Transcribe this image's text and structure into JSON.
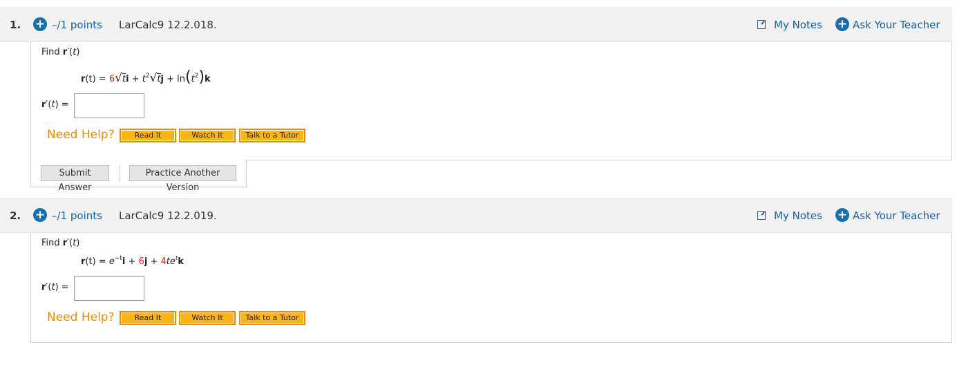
{
  "questions": [
    {
      "number": "1.",
      "points": "–/1 points",
      "code": "LarCalc9 12.2.018.",
      "my_notes": "My Notes",
      "ask_teacher": "Ask Your Teacher",
      "find": {
        "prefix": "Find ",
        "r": "r",
        "prime": "′(",
        "t": "t",
        "close": ")"
      },
      "equation": {
        "lhs": "r",
        "lhs_t": "(t)",
        "eq": " = ",
        "c1": "6",
        "rad1": "t",
        "i": "i",
        "plus1": " + ",
        "t2": "t",
        "sq": "2",
        "rad2": "t",
        "j": "j",
        "plus2": " + ",
        "ln": "ln",
        "arg_t": "t",
        "arg_sq": "2",
        "k": "k"
      },
      "answer_label": "r′(t) =",
      "need_help": "Need Help?",
      "buttons": [
        "Read It",
        "Watch It",
        "Talk to a Tutor"
      ],
      "submit": "Submit Answer",
      "practice": "Practice Another Version"
    },
    {
      "number": "2.",
      "points": "–/1 points",
      "code": "LarCalc9 12.2.019.",
      "my_notes": "My Notes",
      "ask_teacher": "Ask Your Teacher",
      "find": {
        "prefix": "Find ",
        "r": "r",
        "prime": "′(",
        "t": "t",
        "close": ")"
      },
      "equation": {
        "lhs": "r",
        "lhs_t": "(t)",
        "eq": " = ",
        "e": "e",
        "exp": "−t",
        "i": "i",
        "plus1": " + ",
        "c2": "6",
        "j": "j",
        "plus2": " + ",
        "c3": "4",
        "te": "te",
        "exp2": "t",
        "k": "k"
      },
      "answer_label": "r′(t) =",
      "need_help": "Need Help?",
      "buttons": [
        "Read It",
        "Watch It",
        "Talk to a Tutor"
      ]
    }
  ],
  "colors": {
    "link": "#1b5fa0",
    "plus_icon": "#1b6fa8",
    "need_help": "#f08c00",
    "help_button": "#fdb515",
    "highlight_number": "#e3231f"
  }
}
